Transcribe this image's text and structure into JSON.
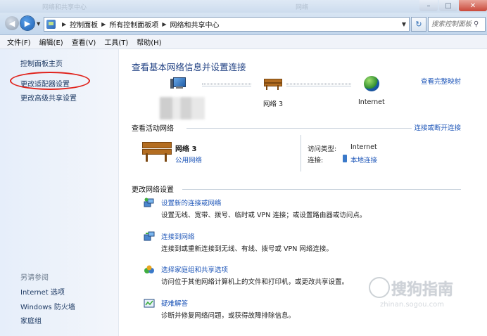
{
  "titlebar": {
    "ghost_left": "网络和共享中心",
    "ghost_mid": "网络"
  },
  "nav": {
    "breadcrumbs": [
      "控制面板",
      "所有控制面板项",
      "网络和共享中心"
    ],
    "search_placeholder": "搜索控制面板"
  },
  "menu": [
    "文件(F)",
    "编辑(E)",
    "查看(V)",
    "工具(T)",
    "帮助(H)"
  ],
  "sidebar": {
    "home": "控制面板主页",
    "links": [
      "更改适配器设置",
      "更改高级共享设置"
    ],
    "see_also_heading": "另请参阅",
    "see_also": [
      "Internet 选项",
      "Windows 防火墙",
      "家庭组"
    ]
  },
  "main": {
    "heading": "查看基本网络信息并设置连接",
    "full_map": "查看完整映射",
    "map": {
      "network": "网络 3",
      "internet": "Internet"
    },
    "active_section": "查看活动网络",
    "connect_disconnect": "连接或断开连接",
    "active_network": {
      "name": "网络 3",
      "type": "公用网络",
      "access_type_label": "访问类型:",
      "access_type_value": "Internet",
      "connection_label": "连接:",
      "connection_value": "本地连接"
    },
    "change_section": "更改网络设置",
    "tasks": [
      {
        "title": "设置新的连接或网络",
        "desc": "设置无线、宽带、拨号、临时或 VPN 连接；或设置路由器或访问点。"
      },
      {
        "title": "连接到网络",
        "desc": "连接到或重新连接到无线、有线、拨号或 VPN 网络连接。"
      },
      {
        "title": "选择家庭组和共享选项",
        "desc": "访问位于其他网络计算机上的文件和打印机，或更改共享设置。"
      },
      {
        "title": "疑难解答",
        "desc": "诊断并修复网络问题，或获得故障排除信息。"
      }
    ]
  },
  "watermark": {
    "text": "搜狗指南",
    "url": "zhinan.sogou.com"
  },
  "colors": {
    "link": "#1e56b8",
    "heading": "#1e3f82",
    "sidebar_link": "#1f3b64",
    "annotation": "#e0221b"
  }
}
